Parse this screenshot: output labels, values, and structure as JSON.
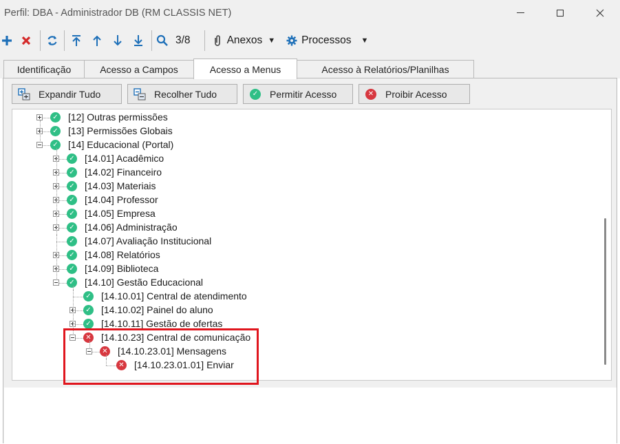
{
  "window": {
    "title": "Perfil: DBA - Administrador DB (RM CLASSIS NET)"
  },
  "toolbar": {
    "record_position": "3/8",
    "anexos_label": "Anexos",
    "processos_label": "Processos"
  },
  "tabs": [
    {
      "label": "Identificação",
      "active": false
    },
    {
      "label": "Acesso a Campos",
      "active": false
    },
    {
      "label": "Acesso a Menus",
      "active": true
    },
    {
      "label": "Acesso à Relatórios/Planilhas",
      "active": false
    }
  ],
  "actions": {
    "expand_all": "Expandir Tudo",
    "collapse_all": "Recolher Tudo",
    "allow_access": "Permitir Acesso",
    "deny_access": "Proibir Acesso"
  },
  "tree": [
    {
      "label": "[12] Outras permissões",
      "level": 1,
      "expander": "plus",
      "status": "allowed"
    },
    {
      "label": "[13] Permissões Globais",
      "level": 1,
      "expander": "plus",
      "status": "allowed"
    },
    {
      "label": "[14] Educacional (Portal)",
      "level": 1,
      "expander": "minus",
      "status": "allowed"
    },
    {
      "label": "[14.01] Acadêmico",
      "level": 2,
      "expander": "plus",
      "status": "allowed"
    },
    {
      "label": "[14.02] Financeiro",
      "level": 2,
      "expander": "plus",
      "status": "allowed"
    },
    {
      "label": "[14.03] Materiais",
      "level": 2,
      "expander": "plus",
      "status": "allowed"
    },
    {
      "label": "[14.04] Professor",
      "level": 2,
      "expander": "plus",
      "status": "allowed"
    },
    {
      "label": "[14.05] Empresa",
      "level": 2,
      "expander": "plus",
      "status": "allowed"
    },
    {
      "label": "[14.06] Administração",
      "level": 2,
      "expander": "plus",
      "status": "allowed"
    },
    {
      "label": "[14.07] Avaliação Institucional",
      "level": 2,
      "expander": "none",
      "status": "allowed"
    },
    {
      "label": "[14.08] Relatórios",
      "level": 2,
      "expander": "plus",
      "status": "allowed"
    },
    {
      "label": "[14.09] Biblioteca",
      "level": 2,
      "expander": "plus",
      "status": "allowed"
    },
    {
      "label": "[14.10] Gestão Educacional",
      "level": 2,
      "expander": "minus",
      "status": "allowed"
    },
    {
      "label": "[14.10.01] Central de atendimento",
      "level": 3,
      "expander": "none",
      "status": "allowed"
    },
    {
      "label": "[14.10.02] Painel do aluno",
      "level": 3,
      "expander": "plus",
      "status": "allowed"
    },
    {
      "label": "[14.10.11] Gestão de ofertas",
      "level": 3,
      "expander": "plus",
      "status": "allowed"
    },
    {
      "label": "[14.10.23] Central de comunicação",
      "level": 3,
      "expander": "minus",
      "status": "denied"
    },
    {
      "label": "[14.10.23.01] Mensagens",
      "level": 4,
      "expander": "minus",
      "status": "denied"
    },
    {
      "label": "[14.10.23.01.01] Enviar",
      "level": 5,
      "expander": "none",
      "status": "denied"
    }
  ],
  "colors": {
    "allowed": "#2fbf86",
    "denied": "#d7373f",
    "highlight_border": "#e0161e"
  }
}
